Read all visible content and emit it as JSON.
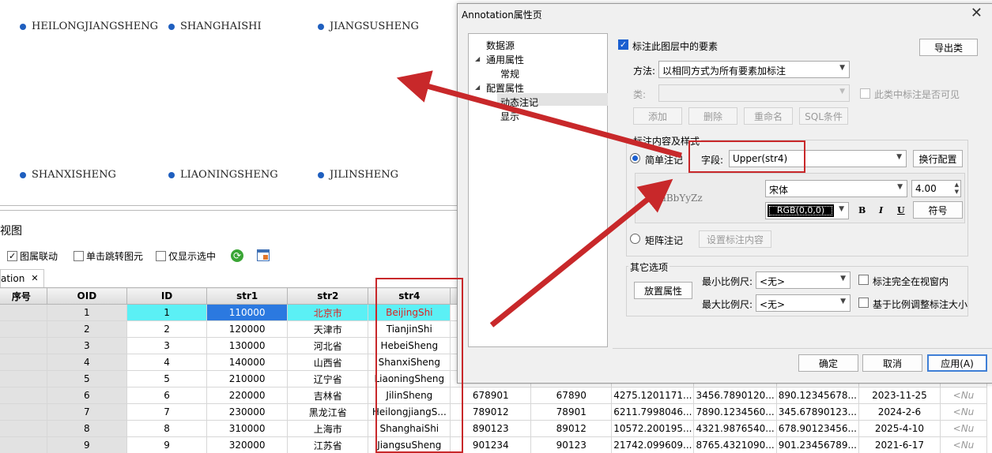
{
  "map": {
    "labels": [
      "HEILONGJIANGSHENG",
      "SHANGHAISHI",
      "JIANGSUSHENG",
      "SHANXISHENG",
      "LIAONINGSHENG",
      "JILINSHENG"
    ],
    "dot_color": "#1f5fbf"
  },
  "table_panel": {
    "title": "视图",
    "toolbar": {
      "link_label": "图属联动",
      "jump_label": "单击跳转图元",
      "only_selected_label": "仅显示选中",
      "refresh_icon": "refresh-icon",
      "table_icon": "table-settings-icon"
    },
    "tab": {
      "label": "ation",
      "close": "✕"
    },
    "columns": [
      "序号",
      "OID",
      "ID",
      "str1",
      "str2",
      "str4",
      "",
      "",
      "",
      "",
      "",
      "",
      ""
    ],
    "rows": [
      [
        "",
        "1",
        "1",
        "110000",
        "北京市",
        "BeijingShi",
        "",
        "",
        "",
        "",
        "",
        "",
        ""
      ],
      [
        "",
        "2",
        "2",
        "120000",
        "天津市",
        "TianjinShi",
        "",
        "",
        "",
        "",
        "",
        "",
        ""
      ],
      [
        "",
        "3",
        "3",
        "130000",
        "河北省",
        "HebeiSheng",
        "",
        "",
        "",
        "",
        "",
        "",
        ""
      ],
      [
        "",
        "4",
        "4",
        "140000",
        "山西省",
        "ShanxiSheng",
        "",
        "",
        "",
        "",
        "",
        "",
        ""
      ],
      [
        "",
        "5",
        "5",
        "210000",
        "辽宁省",
        "LiaoningSheng",
        "",
        "",
        "",
        "",
        "",
        "",
        ""
      ],
      [
        "",
        "6",
        "6",
        "220000",
        "吉林省",
        "JilinSheng",
        "678901",
        "67890",
        "4275.1201171...",
        "3456.7890120...",
        "890.12345678...",
        "2023-11-25",
        "<Nu"
      ],
      [
        "",
        "7",
        "7",
        "230000",
        "黑龙江省",
        "HeilongjiangS...",
        "789012",
        "78901",
        "6211.7998046...",
        "7890.1234560...",
        "345.67890123...",
        "2024-2-6",
        "<Nu"
      ],
      [
        "",
        "8",
        "8",
        "310000",
        "上海市",
        "ShanghaiShi",
        "890123",
        "89012",
        "10572.200195...",
        "4321.9876540...",
        "678.90123456...",
        "2025-4-10",
        "<Nu"
      ],
      [
        "",
        "9",
        "9",
        "320000",
        "江苏省",
        "JiangsuSheng",
        "901234",
        "90123",
        "21742.099609...",
        "8765.4321090...",
        "901.23456789...",
        "2021-6-17",
        "<Nu"
      ]
    ]
  },
  "dialog": {
    "title": "Annotation属性页",
    "close": "✕",
    "tree": {
      "items": [
        "数据源",
        "通用属性",
        "常规",
        "配置属性",
        "动态注记",
        "显示"
      ],
      "expander": "◢"
    },
    "label_features": "标注此图层中的要素",
    "export_button": "导出类",
    "method_label": "方法:",
    "method_value": "以相同方式为所有要素加标注",
    "class_label": "类:",
    "class_visible": "此类中标注是否可见",
    "class_buttons": [
      "添加",
      "删除",
      "重命名",
      "SQL条件"
    ],
    "content_group": "标注内容及样式",
    "simple_label": "简单注记",
    "field_label": "字段:",
    "field_value": "Upper(str4)",
    "wrap_button": "换行配置",
    "preview_text": "AaBbYyZz",
    "font_value": "宋体",
    "font_size": "4.00",
    "color_value": "RGB(0,0,0)",
    "bold": "B",
    "italic": "I",
    "underline": "U",
    "symbol_button": "符号",
    "matrix_label": "矩阵注记",
    "matrix_button": "设置标注内容",
    "other_group": "其它选项",
    "placement_button": "放置属性",
    "min_scale_label": "最小比例尺:",
    "min_scale_value": "<无>",
    "max_scale_label": "最大比例尺:",
    "max_scale_value": "<无>",
    "fully_in_view": "标注完全在视窗内",
    "scale_adjust": "基于比例调整标注大小",
    "ok_button": "确定",
    "cancel_button": "取消",
    "apply_button": "应用(A)"
  },
  "colors": {
    "annotation_red": "#c8282a",
    "highlight_cyan": "#5bf0f5",
    "selection_blue": "#2b79e0"
  }
}
